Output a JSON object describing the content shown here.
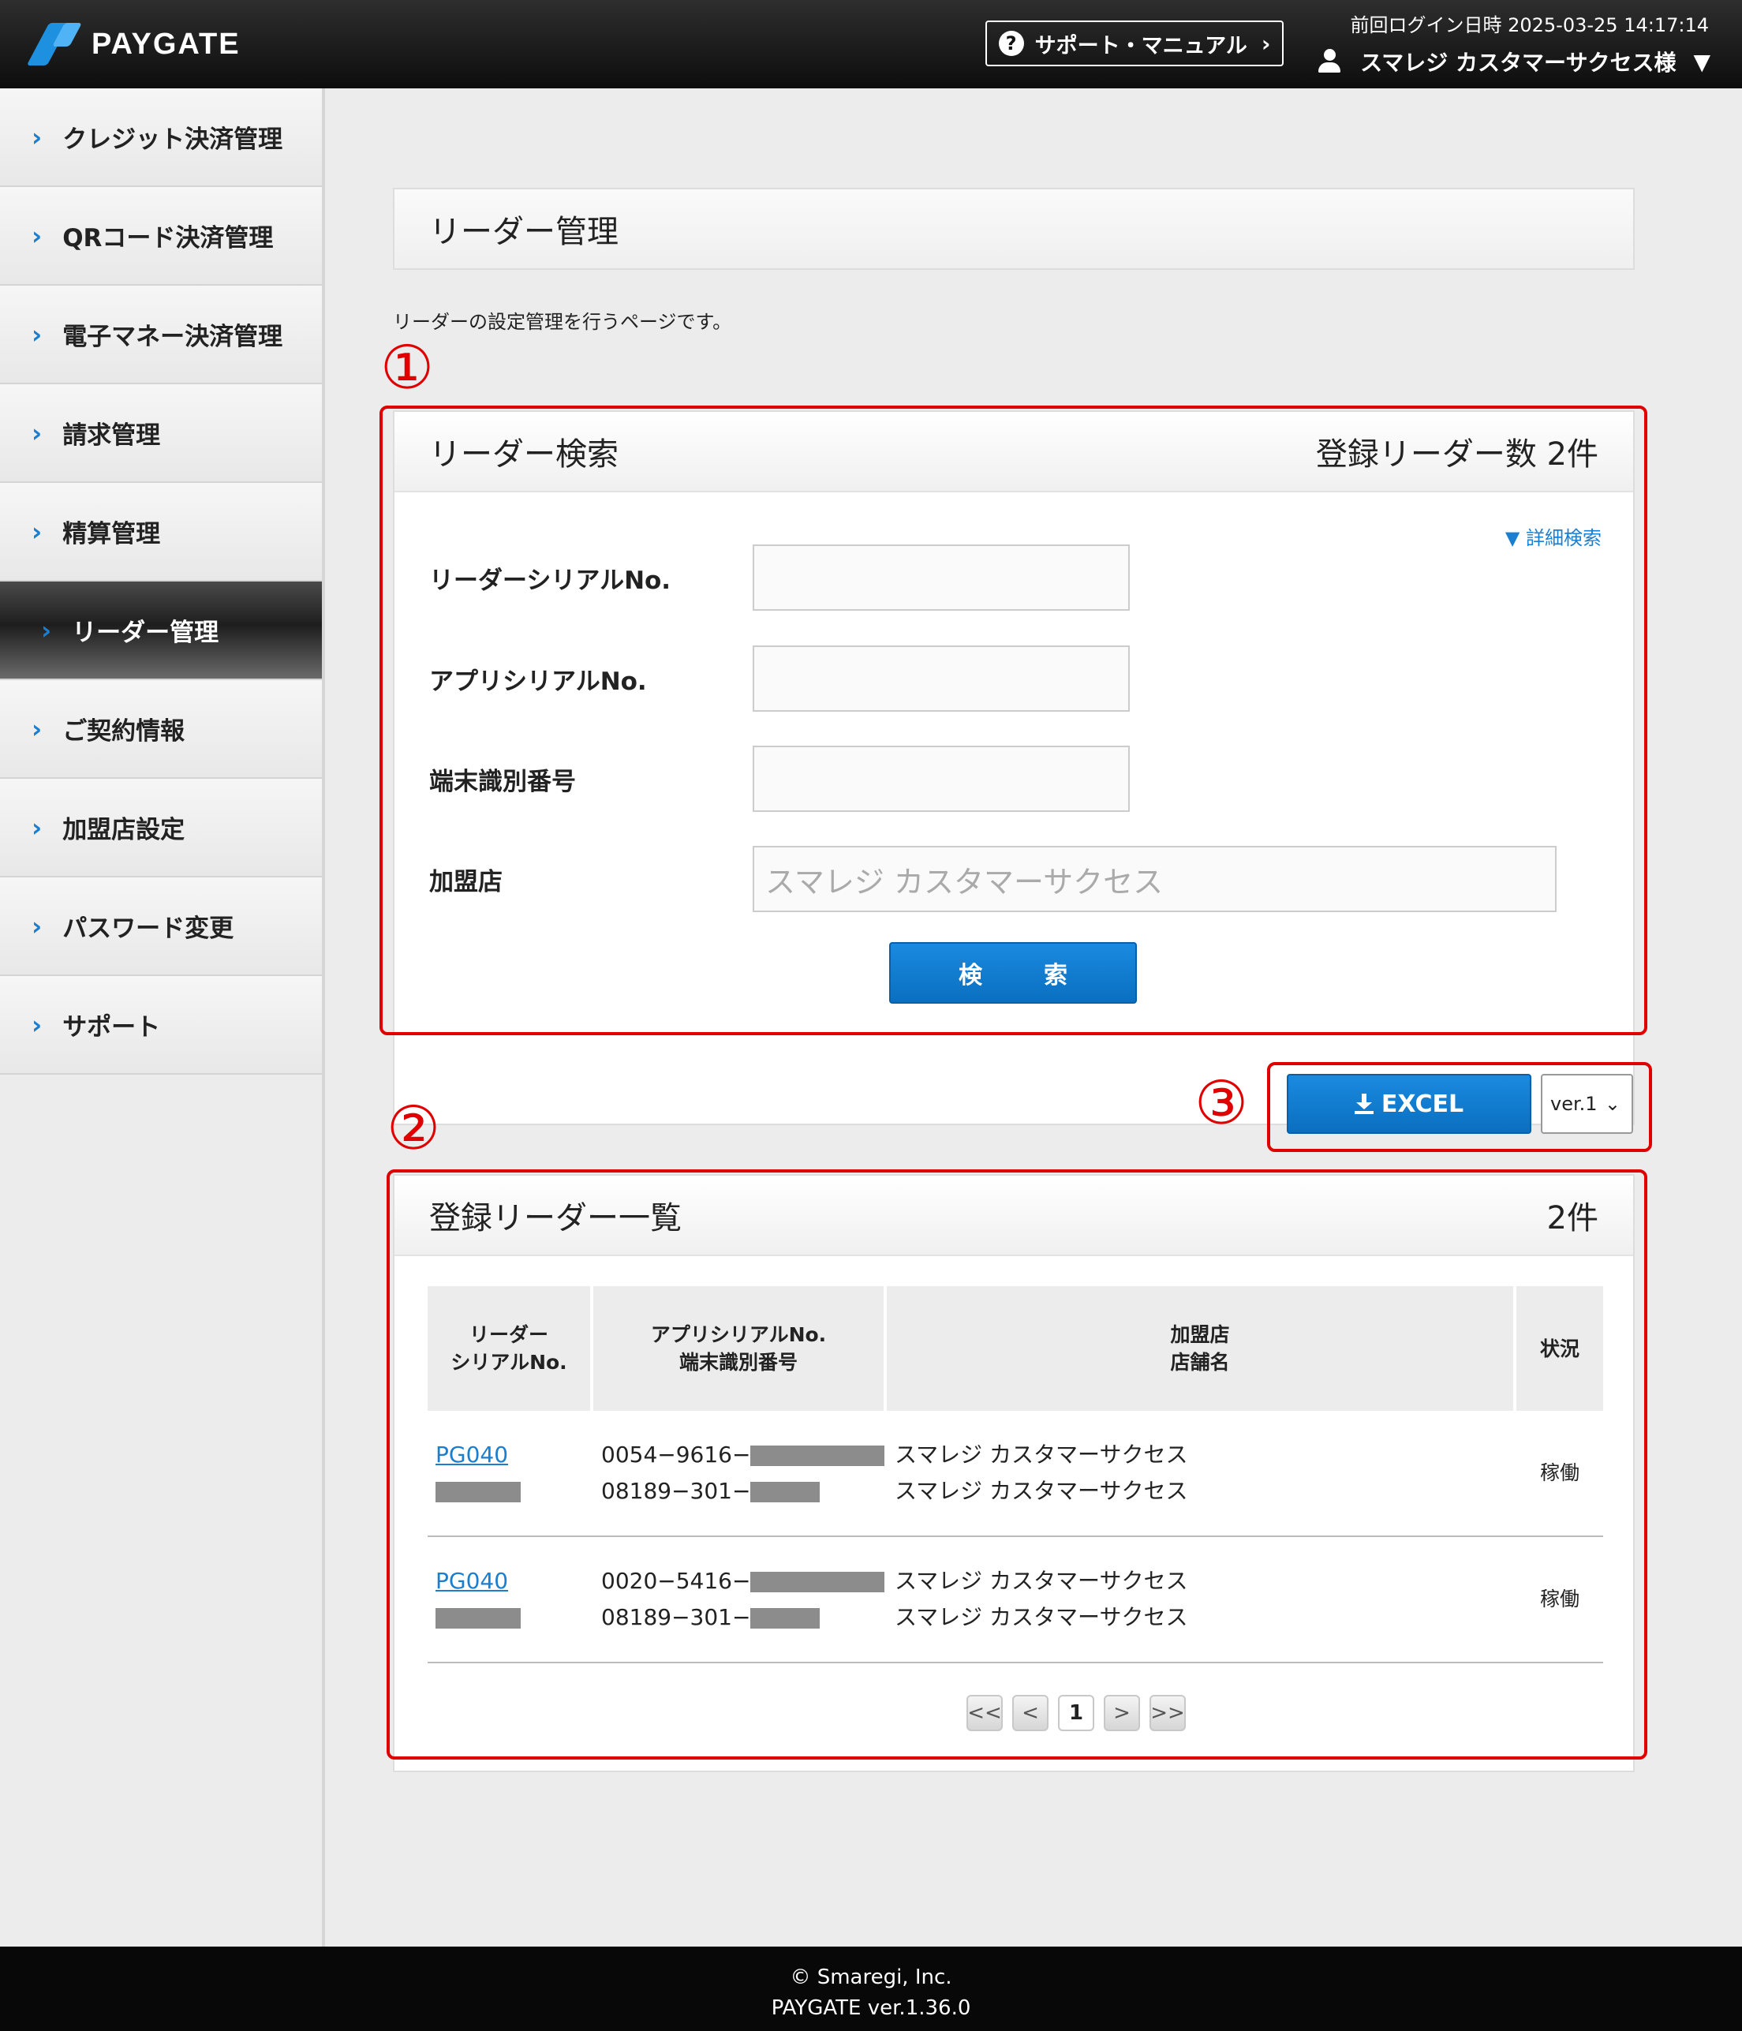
{
  "header": {
    "logo": "PAYGATE",
    "support_label": "サポート・マニュアル",
    "last_login": "前回ログイン日時 2025-03-25 14:17:14",
    "user_name": "スマレジ カスタマーサクセス様"
  },
  "sidebar": {
    "items": [
      {
        "label": "クレジット決済管理"
      },
      {
        "label": "QRコード決済管理"
      },
      {
        "label": "電子マネー決済管理"
      },
      {
        "label": "請求管理"
      },
      {
        "label": "精算管理"
      },
      {
        "label": "リーダー管理"
      },
      {
        "label": "ご契約情報"
      },
      {
        "label": "加盟店設定"
      },
      {
        "label": "パスワード変更"
      },
      {
        "label": "サポート"
      }
    ]
  },
  "page": {
    "title": "リーダー管理",
    "description": "リーダーの設定管理を行うページです。"
  },
  "annotations": {
    "one": "①",
    "two": "②",
    "three": "③"
  },
  "search": {
    "title": "リーダー検索",
    "count": "登録リーダー数 2件",
    "detail_link": "▼ 詳細検索",
    "reader_serial_label": "リーダーシリアルNo.",
    "app_serial_label": "アプリシリアルNo.",
    "terminal_id_label": "端末識別番号",
    "merchant_label": "加盟店",
    "merchant_value": "スマレジ カスタマーサクセス",
    "button": "検　索"
  },
  "export": {
    "excel_label": "EXCEL",
    "version": "ver.1"
  },
  "list": {
    "title": "登録リーダー一覧",
    "count": "2件",
    "headers": {
      "reader_1": "リーダー",
      "reader_2": "シリアルNo.",
      "app_1": "アプリシリアルNo.",
      "app_2": "端末識別番号",
      "merchant_1": "加盟店",
      "merchant_2": "店舗名",
      "status": "状況"
    },
    "rows": [
      {
        "serial": "PG040",
        "app_serial": "0054−9616−",
        "terminal_id": "08189−301−",
        "merchant": "スマレジ カスタマーサクセス",
        "store": "スマレジ カスタマーサクセス",
        "status": "稼働"
      },
      {
        "serial": "PG040",
        "app_serial": "0020−5416−",
        "terminal_id": "08189−301−",
        "merchant": "スマレジ カスタマーサクセス",
        "store": "スマレジ カスタマーサクセス",
        "status": "稼働"
      }
    ]
  },
  "pagination": {
    "first": "<<",
    "prev": "<",
    "current": "1",
    "next": ">",
    "last": ">>"
  },
  "footer": {
    "copyright": "© Smaregi, Inc.",
    "version": "PAYGATE ver.1.36.0"
  }
}
